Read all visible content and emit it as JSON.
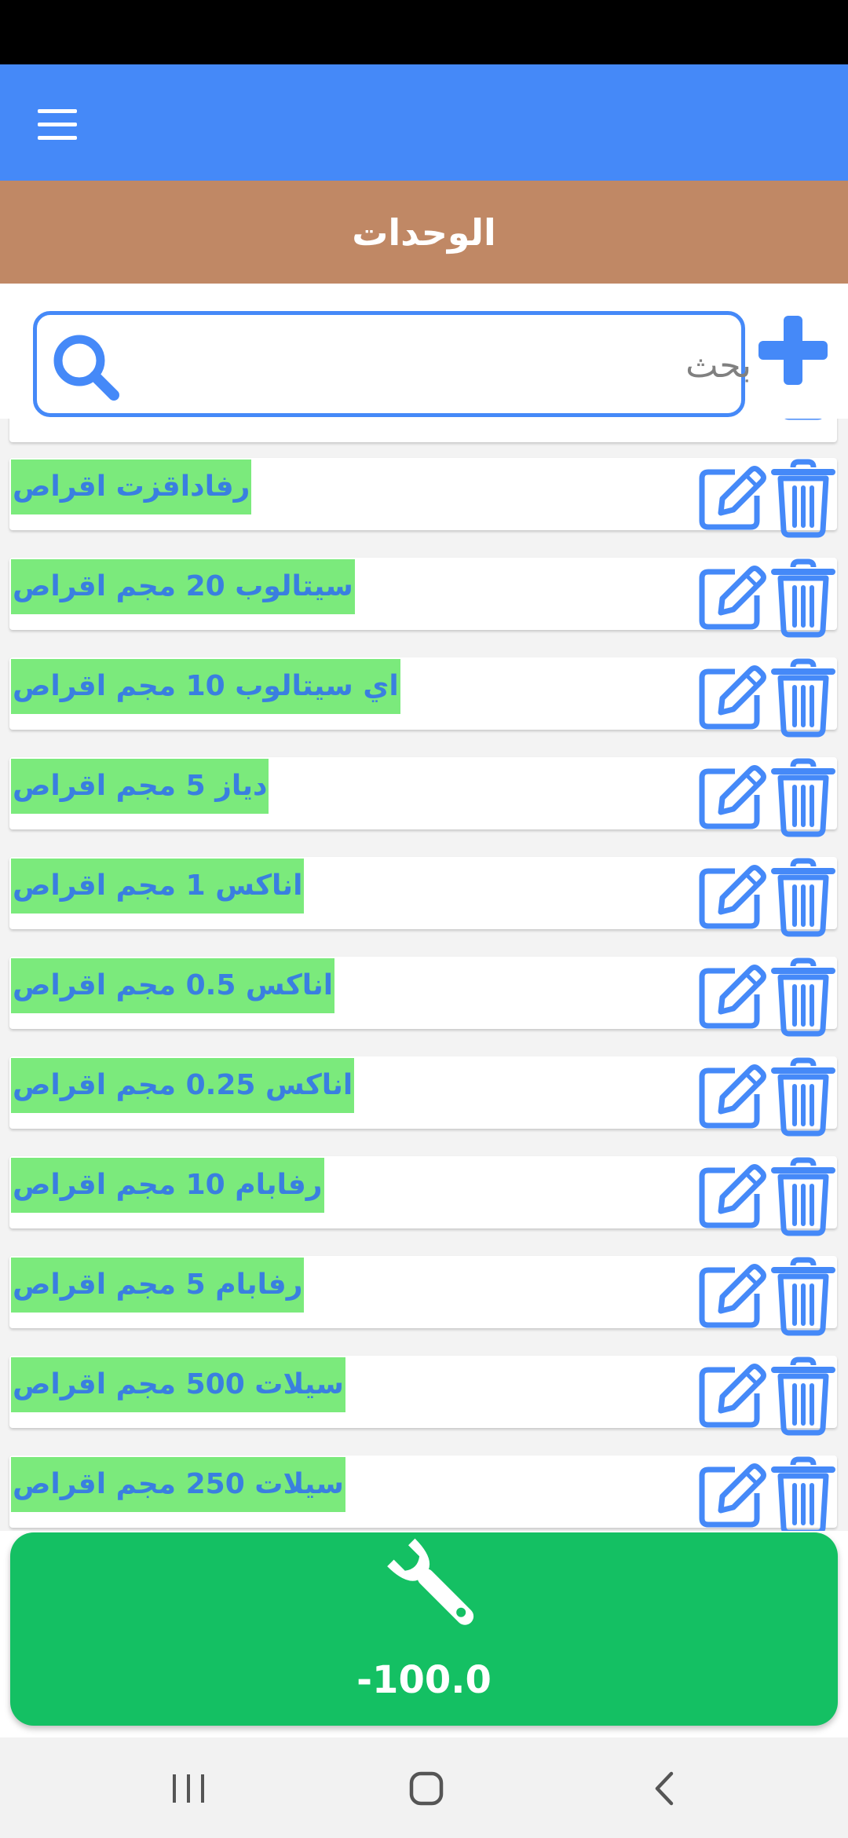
{
  "app_bar": {
    "menu_icon": "hamburger-menu-icon",
    "color": "#4589f8"
  },
  "title_bar": {
    "title": "الوحدات",
    "color": "#c08865"
  },
  "search": {
    "placeholder": "بحث",
    "value": "",
    "icon": "search-icon"
  },
  "add_button": {
    "icon": "plus-icon"
  },
  "units": [
    {
      "name": "رفاداقزت اقراص"
    },
    {
      "name": "سيتالوب 20 مجم اقراص"
    },
    {
      "name": "اي سيتالوب 10 مجم اقراص"
    },
    {
      "name": "دياز 5 مجم اقراص"
    },
    {
      "name": "اناكس 1 مجم اقراص"
    },
    {
      "name": "اناكس 0.5 مجم اقراص"
    },
    {
      "name": "اناكس 0.25 مجم اقراص"
    },
    {
      "name": "رفابام 10 مجم اقراص"
    },
    {
      "name": "رفابام 5 مجم اقراص"
    },
    {
      "name": "سيلات 500 مجم اقراص"
    },
    {
      "name": "سيلات 250 مجم اقراص"
    }
  ],
  "row_actions": {
    "edit_icon": "edit-icon",
    "delete_icon": "trash-icon"
  },
  "fab": {
    "icon": "wrench-icon",
    "value": "-100.0",
    "color": "#14c063"
  },
  "nav": {
    "recents_icon": "recents-icon",
    "home_icon": "home-icon",
    "back_icon": "back-icon"
  },
  "colors": {
    "label_highlight": "#7bea7c",
    "label_text": "#3a7fe0",
    "accent": "#4589f8"
  }
}
